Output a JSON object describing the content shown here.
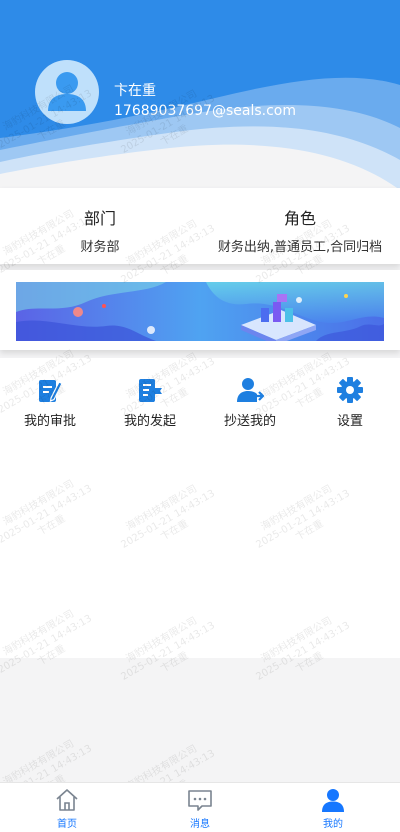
{
  "user": {
    "name": "卞在重",
    "email": "17689037697@seals.com"
  },
  "info": {
    "dept_title": "部门",
    "dept_value": "财务部",
    "role_title": "角色",
    "role_value": "财务出纳,普通员工,合同归档"
  },
  "menu": [
    {
      "label": "我的审批",
      "icon": "edit-document-icon"
    },
    {
      "label": "我的发起",
      "icon": "flag-document-icon"
    },
    {
      "label": "抄送我的",
      "icon": "user-send-icon"
    },
    {
      "label": "设置",
      "icon": "gear-icon"
    }
  ],
  "watermark": {
    "company": "海豹科技有限公司",
    "datetime": "2025-01-21 14:43:13",
    "user": "卞在重"
  },
  "tabs": [
    {
      "label": "首页",
      "icon": "home-icon",
      "active": false
    },
    {
      "label": "消息",
      "icon": "message-icon",
      "active": false
    },
    {
      "label": "我的",
      "icon": "user-icon",
      "active": true
    }
  ],
  "colors": {
    "primary": "#1a86e8",
    "icon_blue": "#1e7fe0",
    "tab_inactive": "#7a8490",
    "tab_active": "#1677ff"
  }
}
